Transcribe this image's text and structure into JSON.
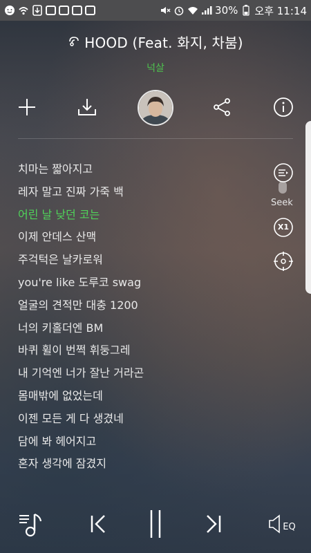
{
  "status_bar": {
    "time": "오후 11:14",
    "battery": "30%",
    "icons_left": [
      "baby-face-icon",
      "wifi-call-icon",
      "download-notify-icon",
      "app-notify-icon",
      "app-notify-icon",
      "app-notify-icon",
      "app-notify-icon"
    ],
    "icons_right": [
      "mute-icon",
      "alarm-icon",
      "wifi-icon",
      "signal-icon",
      "battery-icon"
    ]
  },
  "player": {
    "title": "HOOD (Feat. 화지, 차붐)",
    "artist": "넉살",
    "actions": [
      "add-icon",
      "download-icon",
      "artist-avatar",
      "share-icon",
      "info-icon"
    ]
  },
  "lyrics": [
    {
      "text": "치마는 짧아지고",
      "active": false
    },
    {
      "text": "레자 말고 진짜 가죽 백",
      "active": false
    },
    {
      "text": "어린 날 낮던 코는",
      "active": true
    },
    {
      "text": "이제 안데스 산맥",
      "active": false
    },
    {
      "text": "주걱턱은 날카로워",
      "active": false
    },
    {
      "text": "you're like 도루코 swag",
      "active": false
    },
    {
      "text": "얼굴의 견적만 대충 1200",
      "active": false
    },
    {
      "text": "너의 키홀더엔 BM",
      "active": false
    },
    {
      "text": "바퀴 휠이 번쩍 휘둥그레",
      "active": false
    },
    {
      "text": "내 기억엔 너가 잘난 거라곤",
      "active": false
    },
    {
      "text": "몸매밖에 없었는데",
      "active": false
    },
    {
      "text": "이젠 모든 게 다 생겼네",
      "active": false
    },
    {
      "text": "담에 봐 헤어지고",
      "active": false
    },
    {
      "text": "혼자 생각에 잠겼지",
      "active": false
    }
  ],
  "side_controls": {
    "seek_label": "Seek",
    "speed_label": "X1"
  },
  "bottom_controls": {
    "eq_label": "EQ"
  },
  "colors": {
    "active_lyric": "#50d45a",
    "artist": "#4ec24e"
  }
}
